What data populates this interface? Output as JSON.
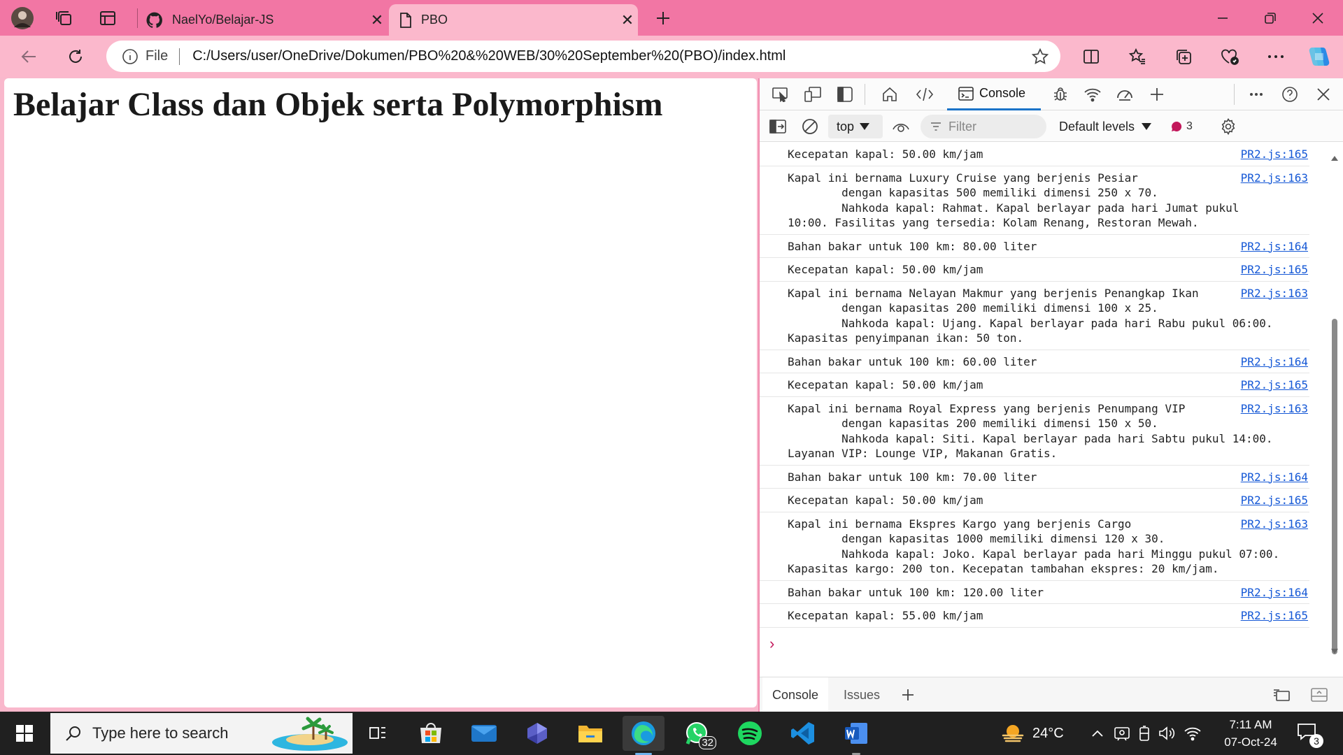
{
  "browser": {
    "tabs": [
      {
        "title": "NaelYo/Belajar-JS",
        "icon": "github-icon",
        "active": false
      },
      {
        "title": "PBO",
        "icon": "file-icon",
        "active": true
      }
    ],
    "address": {
      "scheme_label": "File",
      "url": "C:/Users/user/OneDrive/Dokumen/PBO%20&%20WEB/30%20September%20(PBO)/index.html"
    }
  },
  "page": {
    "heading": "Belajar Class dan Objek serta Polymorphism"
  },
  "devtools": {
    "active_tab": "Console",
    "context": "top",
    "filter_placeholder": "Filter",
    "levels": "Default levels",
    "issues_count": "3",
    "drawer_tabs": [
      "Console",
      "Issues"
    ],
    "log": [
      {
        "msg": "Kecepatan kapal: 50.00 km/jam",
        "src": "PR2.js:165"
      },
      {
        "msg": "Kapal ini bernama Luxury Cruise yang berjenis Pesiar\n        dengan kapasitas 500 memiliki dimensi 250 x 70.\n        Nahkoda kapal: Rahmat. Kapal berlayar pada hari Jumat pukul\n10:00. Fasilitas yang tersedia: Kolam Renang, Restoran Mewah.",
        "src": "PR2.js:163"
      },
      {
        "msg": "Bahan bakar untuk 100 km: 80.00 liter",
        "src": "PR2.js:164"
      },
      {
        "msg": "Kecepatan kapal: 50.00 km/jam",
        "src": "PR2.js:165"
      },
      {
        "msg": "Kapal ini bernama Nelayan Makmur yang berjenis Penangkap Ikan\n        dengan kapasitas 200 memiliki dimensi 100 x 25.\n        Nahkoda kapal: Ujang. Kapal berlayar pada hari Rabu pukul 06:00.\nKapasitas penyimpanan ikan: 50 ton.",
        "src": "PR2.js:163"
      },
      {
        "msg": "Bahan bakar untuk 100 km: 60.00 liter",
        "src": "PR2.js:164"
      },
      {
        "msg": "Kecepatan kapal: 50.00 km/jam",
        "src": "PR2.js:165"
      },
      {
        "msg": "Kapal ini bernama Royal Express yang berjenis Penumpang VIP\n        dengan kapasitas 200 memiliki dimensi 150 x 50.\n        Nahkoda kapal: Siti. Kapal berlayar pada hari Sabtu pukul 14:00.\nLayanan VIP: Lounge VIP, Makanan Gratis.",
        "src": "PR2.js:163"
      },
      {
        "msg": "Bahan bakar untuk 100 km: 70.00 liter",
        "src": "PR2.js:164"
      },
      {
        "msg": "Kecepatan kapal: 50.00 km/jam",
        "src": "PR2.js:165"
      },
      {
        "msg": "Kapal ini bernama Ekspres Kargo yang berjenis Cargo\n        dengan kapasitas 1000 memiliki dimensi 120 x 30.\n        Nahkoda kapal: Joko. Kapal berlayar pada hari Minggu pukul 07:00.\nKapasitas kargo: 200 ton. Kecepatan tambahan ekspres: 20 km/jam.",
        "src": "PR2.js:163"
      },
      {
        "msg": "Bahan bakar untuk 100 km: 120.00 liter",
        "src": "PR2.js:164"
      },
      {
        "msg": "Kecepatan kapal: 55.00 km/jam",
        "src": "PR2.js:165"
      }
    ]
  },
  "taskbar": {
    "search_placeholder": "Type here to search",
    "whatsapp_badge": "32",
    "weather": "24°C",
    "time": "7:11 AM",
    "date": "07-Oct-24",
    "notification_count": "3"
  },
  "colors": {
    "accent": "#f276a4",
    "link": "#1558d6",
    "console_tab_underline": "#1a73c8"
  }
}
